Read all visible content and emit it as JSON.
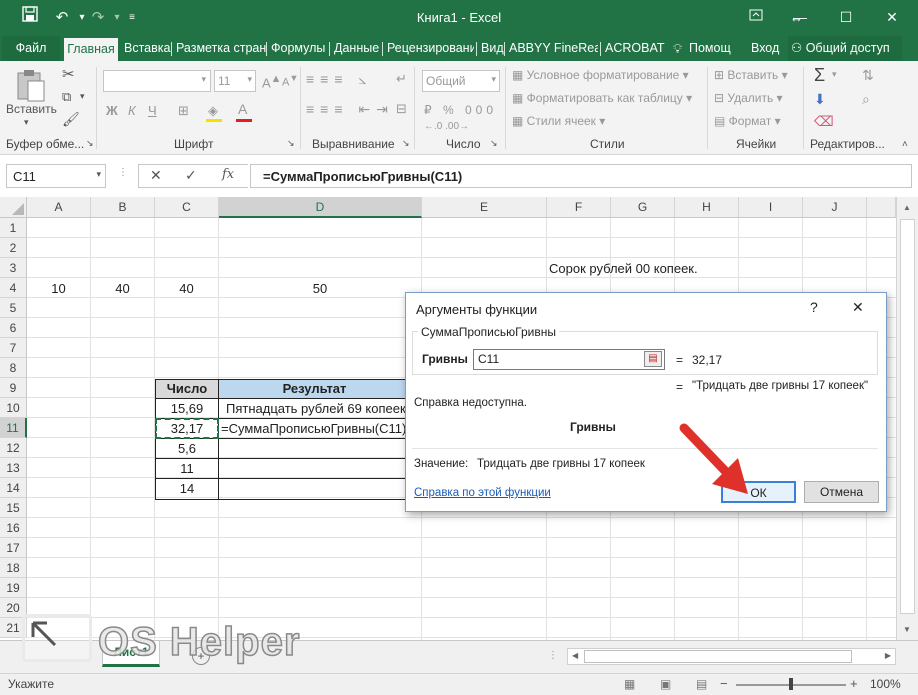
{
  "window": {
    "title": "Книга1 - Excel"
  },
  "ribbon_tabs": [
    "Файл",
    "Главная",
    "Вставка",
    "Разметка стран",
    "Формулы",
    "Данные",
    "Рецензировани",
    "Вид",
    "ABBYY FineReac",
    "ACROBAT",
    "Помощ",
    "Вход",
    "Общий доступ"
  ],
  "ribbon": {
    "paste": "Вставить",
    "font_name": "",
    "font_size": "11",
    "number_format": "Общий",
    "bold": "Ж",
    "italic": "К",
    "underline": "Ч",
    "cond_format": "Условное форматирование",
    "format_table": "Форматировать как таблицу",
    "cell_styles": "Стили ячеек",
    "insert": "Вставить",
    "delete": "Удалить",
    "format": "Формат",
    "groups": [
      "Буфер обме...",
      "Шрифт",
      "Выравнивание",
      "Число",
      "Стили",
      "Ячейки",
      "Редактиров..."
    ]
  },
  "formula_bar": {
    "name_box": "C11",
    "formula": "=СуммаПрописьюГривны(C11)",
    "fx": "fx"
  },
  "columns": [
    "A",
    "B",
    "C",
    "D",
    "E",
    "F",
    "G",
    "H",
    "I",
    "J"
  ],
  "rows": [
    "1",
    "2",
    "3",
    "4",
    "5",
    "6",
    "7",
    "8",
    "9",
    "10",
    "11",
    "12",
    "13",
    "14",
    "15",
    "16",
    "17",
    "18",
    "19",
    "20",
    "21"
  ],
  "cells": {
    "F3": "Сорок рублей  00 копеек.",
    "A4": "10",
    "B4": "40",
    "C4": "40",
    "D4": "50",
    "C9": "Число",
    "D9": "Результат",
    "C10": "15,69",
    "D10": "Пятнадцать рублей 69 копеек",
    "C11": "32,17",
    "D11": "=СуммаПрописьюГривны(C11)",
    "C12": "5,6",
    "C13": "11",
    "C14": "14"
  },
  "dialog": {
    "title": "Аргументы функции",
    "help_q": "?",
    "close": "✕",
    "func_name": "СуммаПрописьюГривны",
    "arg_label": "Гривны",
    "arg_value": "C11",
    "arg_result": "32,17",
    "func_result": "\"Тридцать две гривны 17 копеек\"",
    "no_help": "Справка недоступна.",
    "arg_desc": "Гривны",
    "value_label": "Значение:",
    "value_text": "Тридцать две гривны 17 копеек",
    "help_link": "Справка по этой функции",
    "ok": "ОК",
    "cancel": "Отмена"
  },
  "sheet_tabs": [
    "Лист1"
  ],
  "status": {
    "mode": "Укажите",
    "zoom": "100%"
  },
  "watermark": {
    "text": "OS Helper"
  },
  "colors": {
    "excel_green": "#217346",
    "arrow_red": "#e0302a",
    "link_blue": "#1a5cb5"
  }
}
